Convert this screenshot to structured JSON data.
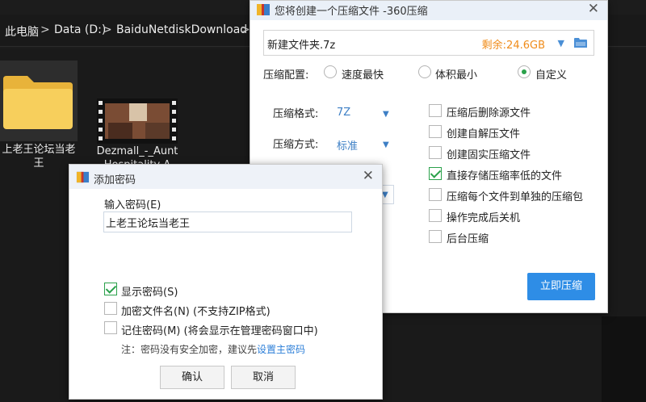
{
  "explorer": {
    "breadcrumb": [
      "此电脑",
      "Data (D:)",
      "BaiduNetdiskDownload"
    ],
    "separator": ">",
    "folder_label": "上老王论坛当老王",
    "video_label": "Dezmall_-_Aunt Hospitality A"
  },
  "compress_dialog": {
    "title": "您将创建一个压缩文件 -360压缩",
    "close": "✕",
    "file_name": "新建文件夹.7z",
    "space_left": "剩余:24.6GB",
    "config_label": "压缩配置:",
    "modes": [
      {
        "label": "速度最快",
        "selected": false
      },
      {
        "label": "体积最小",
        "selected": false
      },
      {
        "label": "自定义",
        "selected": true
      }
    ],
    "format_label": "压缩格式:",
    "format_value": "7Z",
    "method_label": "压缩方式:",
    "method_value": "标准",
    "options": [
      {
        "label": "压缩后删除源文件",
        "checked": false
      },
      {
        "label": "创建自解压文件",
        "checked": false
      },
      {
        "label": "创建固实压缩文件",
        "checked": false
      },
      {
        "label": "直接存储压缩率低的文件",
        "checked": true
      },
      {
        "label": "压缩每个文件到单独的压缩包",
        "checked": false
      },
      {
        "label": "操作完成后关机",
        "checked": false
      },
      {
        "label": "后台压缩",
        "checked": false
      }
    ],
    "start_button": "立即压缩"
  },
  "password_dialog": {
    "title": "添加密码",
    "close": "✕",
    "input_label": "输入密码(E)",
    "password_value": "上老王论坛当老王",
    "options": [
      {
        "label": "显示密码(S)",
        "checked": true
      },
      {
        "label": "加密文件名(N) (不支持ZIP格式)",
        "checked": false
      },
      {
        "label": "记住密码(M) (将会显示在管理密码窗口中)",
        "checked": false
      }
    ],
    "note": "注：密码没有安全加密，建议先",
    "note_link": "设置主密码",
    "ok_button": "确认",
    "cancel_button": "取消"
  },
  "colors": {
    "accent": "#2e8de6",
    "check_green": "#2ba14b",
    "space_orange": "#f08c1a",
    "link_blue": "#2d7fd8"
  }
}
